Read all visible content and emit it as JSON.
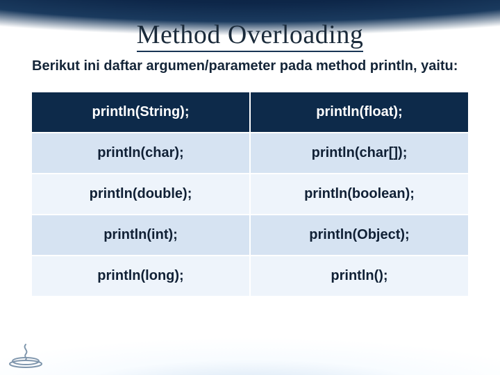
{
  "title": "Method Overloading",
  "subtitle": "Berikut ini daftar argumen/parameter pada method println, yaitu:",
  "table": {
    "rows": [
      {
        "left": "println(String);",
        "right": "println(float);"
      },
      {
        "left": "println(char);",
        "right": "println(char[]);"
      },
      {
        "left": "println(double);",
        "right": "println(boolean);"
      },
      {
        "left": "println(int);",
        "right": "println(Object);"
      },
      {
        "left": "println(long);",
        "right": "println();"
      }
    ]
  }
}
